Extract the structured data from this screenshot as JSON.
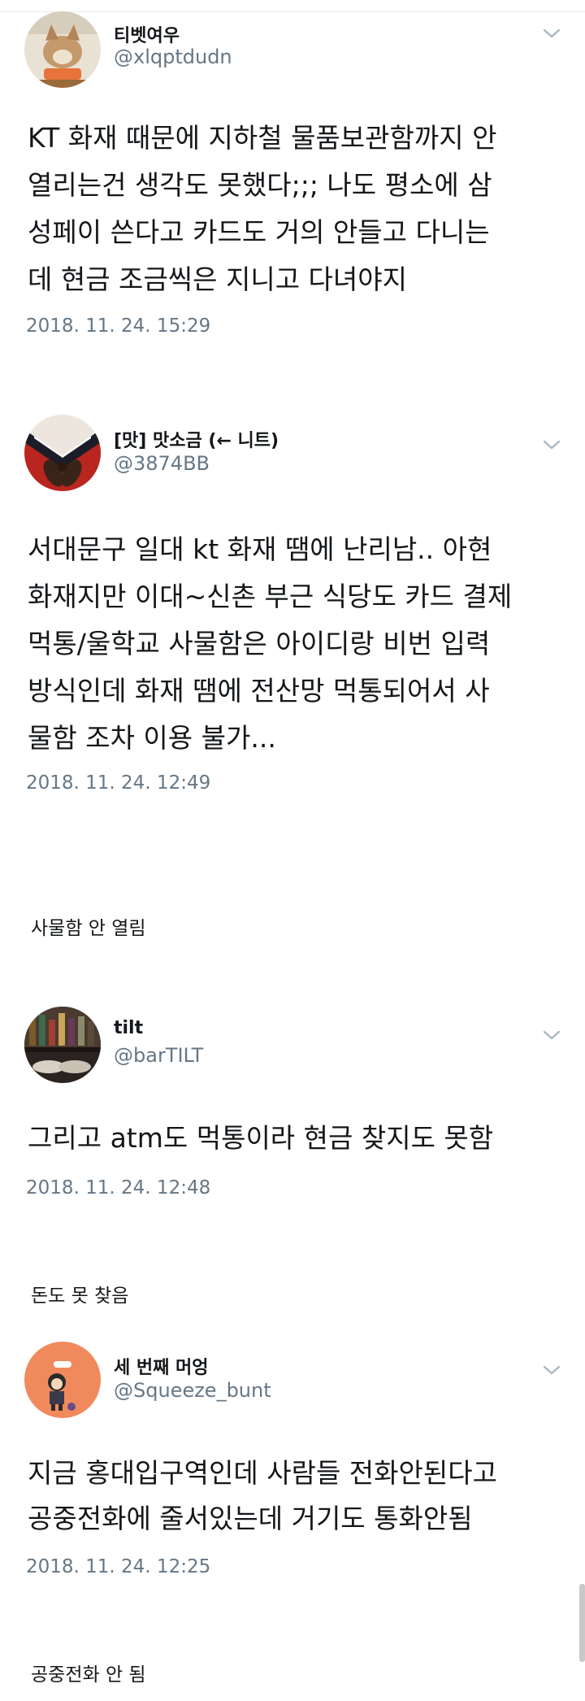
{
  "tweets": [
    {
      "name": "티벳여우",
      "handle": "@xlqptdudn",
      "body": [
        "KT 화재 때문에 지하철 물품보관함까지 안",
        "열리는건 생각도 못했다;;; 나도 평소에 삼",
        "성페이 쓴다고 카드도 거의 안들고 다니는",
        "데 현금 조금씩은 지니고 다녀야지"
      ],
      "timestamp": "2018. 11. 24. 15:29"
    },
    {
      "name": "[맛] 맛소금 (← 니트)",
      "handle": "@3874BB",
      "body": [
        "서대문구 일대 kt 화재 땜에 난리남.. 아현",
        "화재지만 이대~신촌 부근 식당도 카드 결제",
        "먹통/울학교 사물함은 아이디랑 비번 입력",
        "방식인데 화재 땜에 전산망 먹통되어서 사",
        "물함 조차 이용 불가..."
      ],
      "timestamp": "2018. 11. 24. 12:49"
    },
    {
      "name": "tilt",
      "handle": "@barTILT",
      "body": [
        "그리고 atm도 먹통이라 현금 찾지도 못함"
      ],
      "timestamp": "2018. 11. 24. 12:48"
    },
    {
      "name": "세 번째 머엉",
      "handle": "@Squeeze_bunt",
      "body": [
        "지금 홍대입구역인데 사람들 전화안된다고",
        "공중전화에 줄서있는데 거기도 통화안됨"
      ],
      "timestamp": "2018. 11. 24. 12:25"
    }
  ],
  "captions": [
    "사물함 안 열림",
    "돈도 못 찾음",
    "공중전화 안 됨"
  ],
  "icons": {
    "more": "chevron-down-icon"
  },
  "colors": {
    "text": "#14171a",
    "muted": "#657786",
    "chevron": "#aab8c2",
    "avatar_orange": "#f08a5d"
  }
}
